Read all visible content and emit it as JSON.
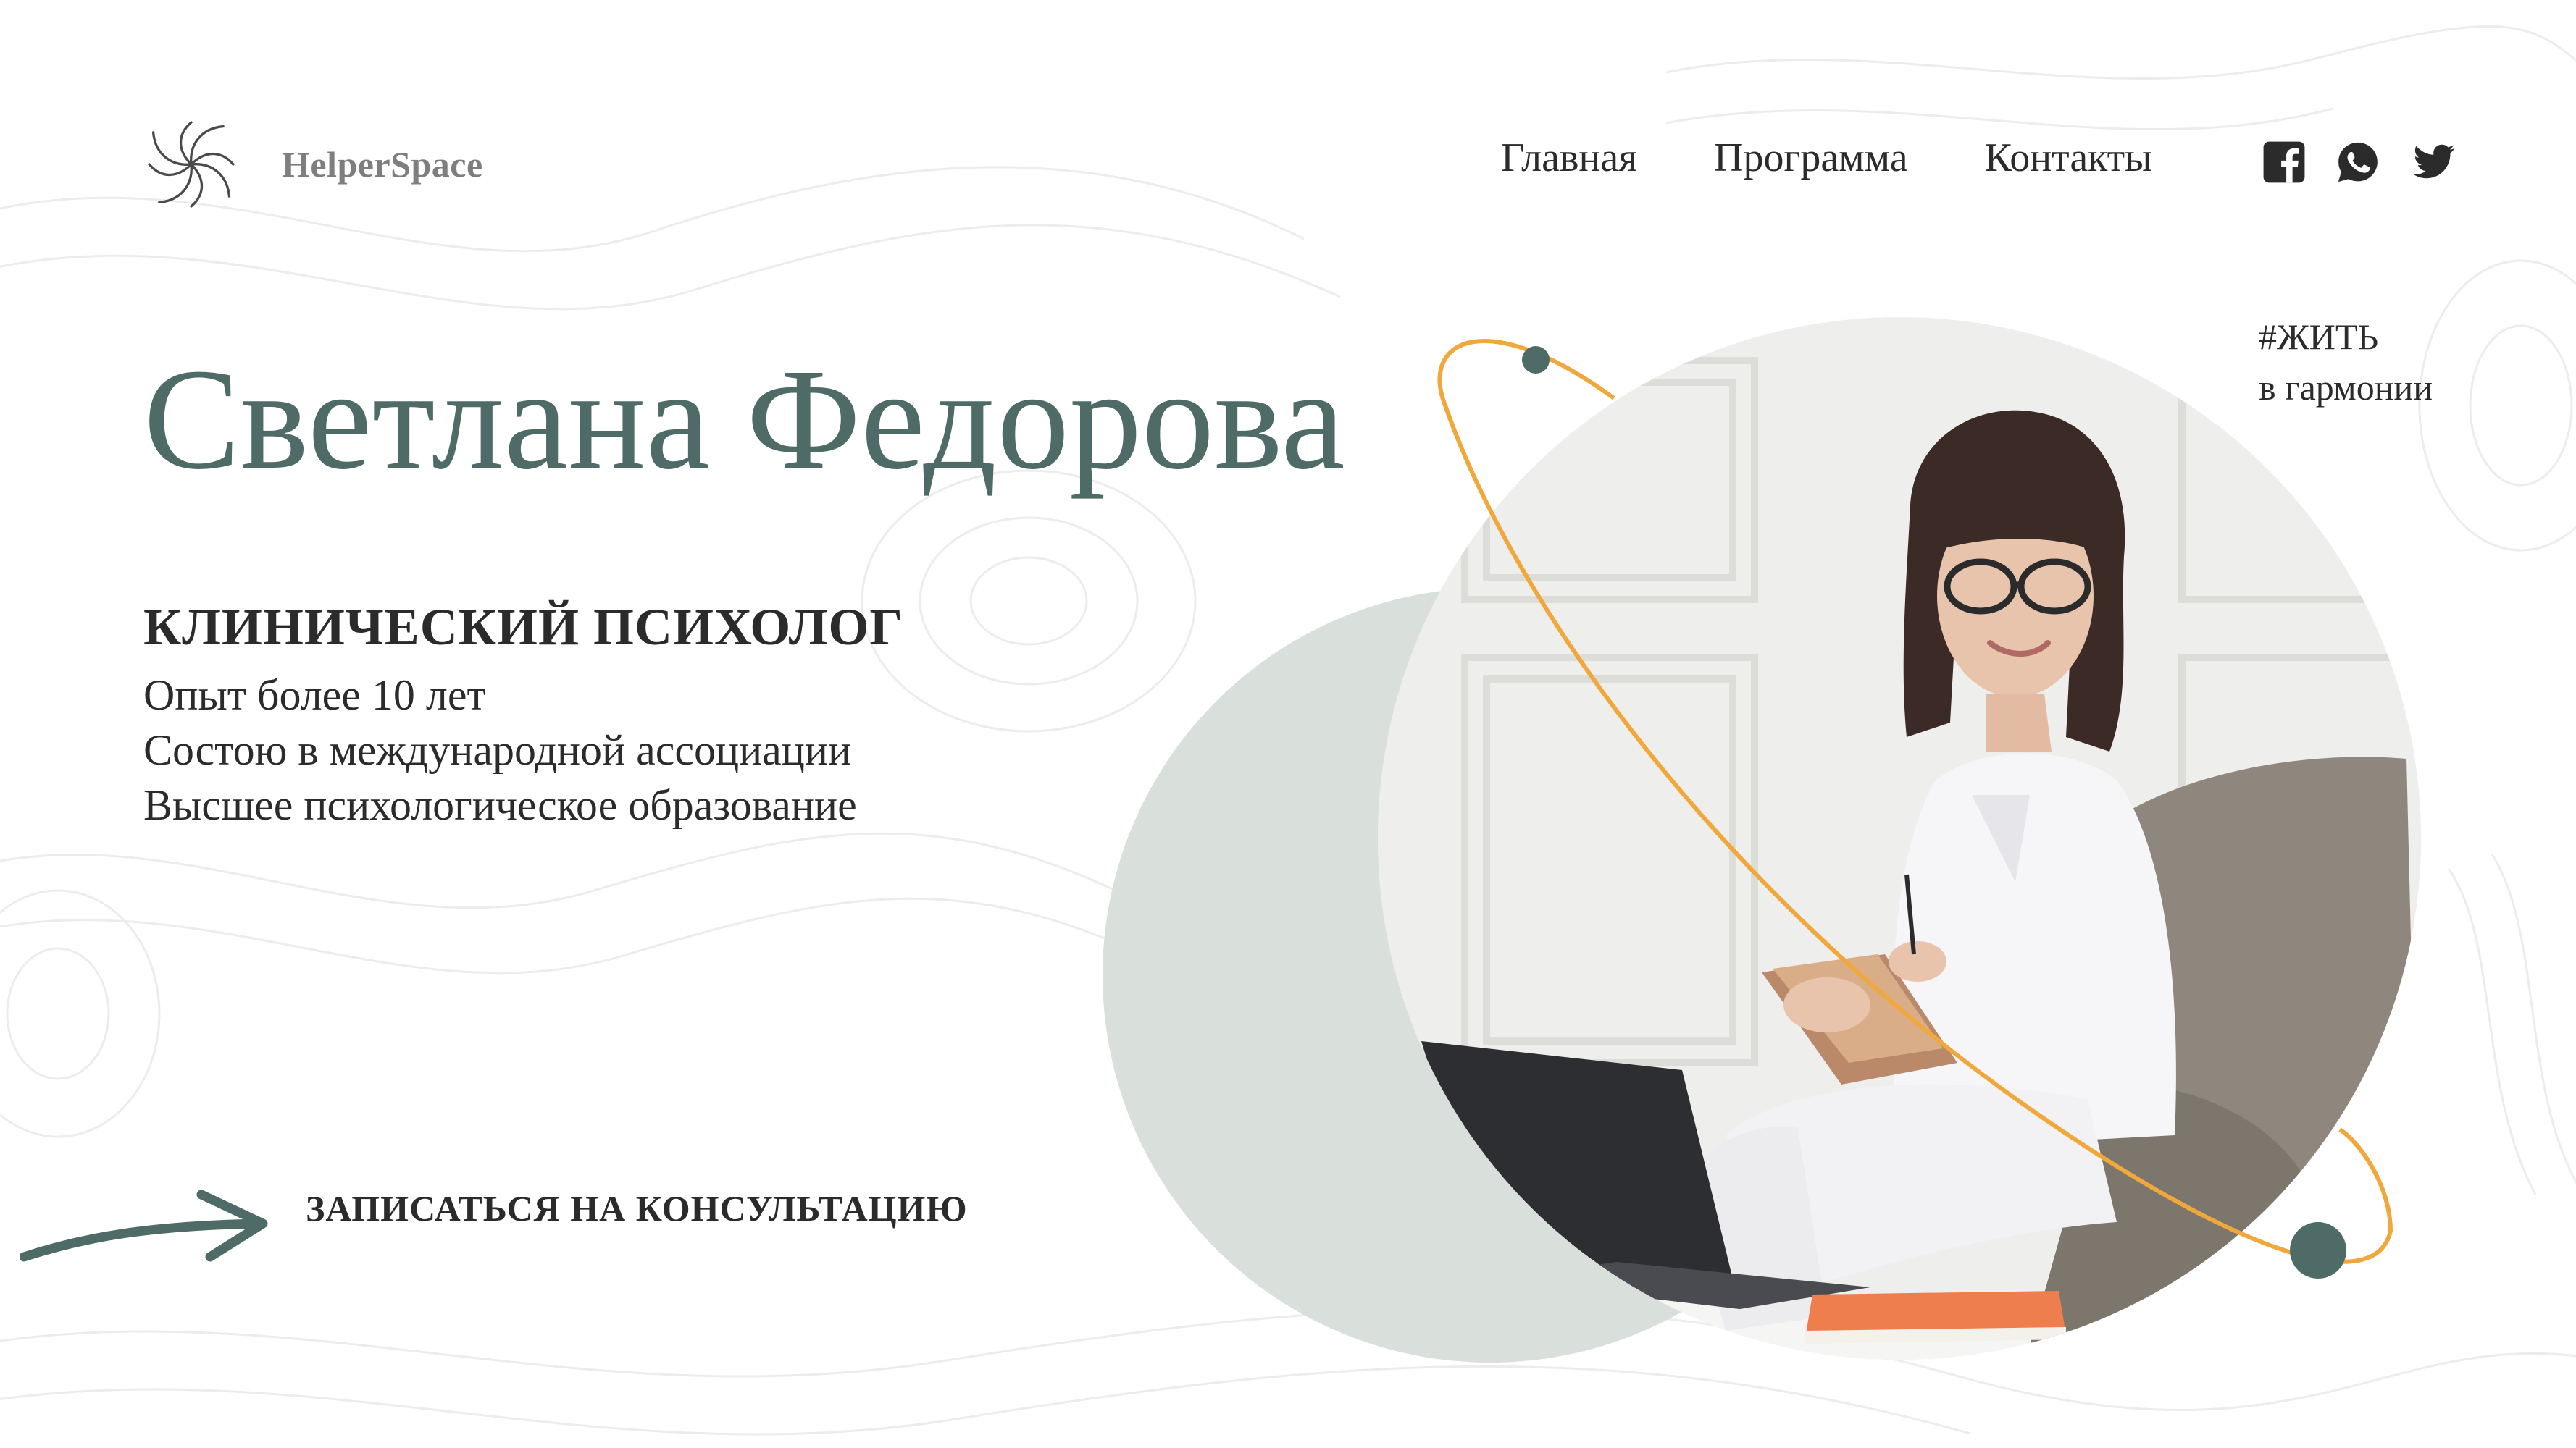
{
  "brand": {
    "name": "HelperSpace",
    "logo_icon": "swirl-logo-icon"
  },
  "nav": {
    "items": [
      {
        "label": "Главная"
      },
      {
        "label": "Программа"
      },
      {
        "label": "Контакты"
      }
    ]
  },
  "socials": [
    {
      "icon": "facebook-icon"
    },
    {
      "icon": "whatsapp-icon"
    },
    {
      "icon": "twitter-icon"
    }
  ],
  "hero": {
    "name": "Светлана Федорова",
    "profession": "КЛИНИЧЕСКИЙ ПСИХОЛОГ",
    "facts": [
      "Опыт более 10 лет",
      "Состою в международной ассоциации",
      "Высшее психологическое образование"
    ],
    "cta": "ЗАПИСАТЬСЯ НА КОНСУЛЬТАЦИЮ"
  },
  "tagline": {
    "line1": "#ЖИТЬ",
    "line2": "в гармонии"
  },
  "colors": {
    "accent_green": "#4f6b67",
    "soft_green": "#d9e0dc",
    "orbit_orange": "#f0a83c",
    "text_dark": "#2b2b2b",
    "logo_grey": "#7e7e7e"
  }
}
